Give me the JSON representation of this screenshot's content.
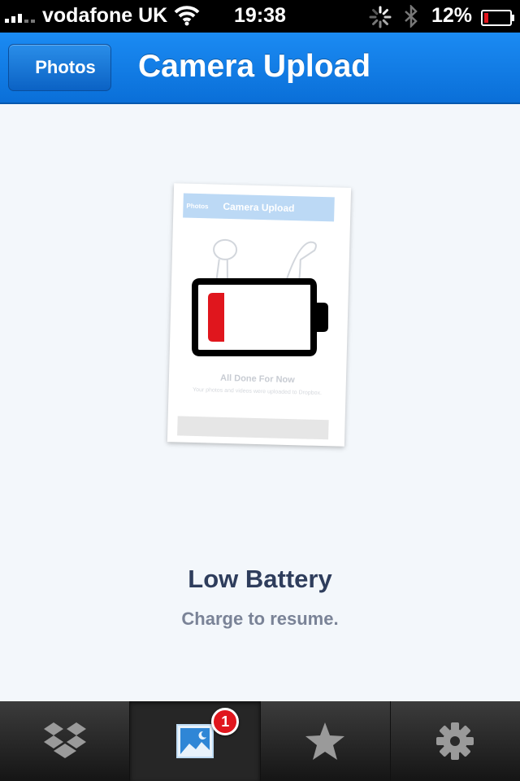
{
  "status_bar": {
    "carrier": "vodafone UK",
    "time": "19:38",
    "battery_percent": "12%",
    "icons": [
      "signal-icon",
      "wifi-icon",
      "activity-spinner-icon",
      "bluetooth-icon",
      "battery-icon"
    ]
  },
  "nav": {
    "back_label": "Photos",
    "title": "Camera Upload"
  },
  "preview": {
    "nav_title": "Camera Upload",
    "back_label": "Photos",
    "title": "All Done For Now",
    "subtitle": "Your photos and videos were uploaded to Dropbox."
  },
  "message": {
    "title": "Low Battery",
    "subtitle": "Charge to resume."
  },
  "tabs": [
    {
      "name": "dropbox",
      "icon": "dropbox-icon",
      "active": false
    },
    {
      "name": "photos",
      "icon": "photos-icon",
      "active": true,
      "badge": "1"
    },
    {
      "name": "favorites",
      "icon": "star-icon",
      "active": false
    },
    {
      "name": "settings",
      "icon": "gear-icon",
      "active": false
    }
  ],
  "colors": {
    "nav_blue": "#0a6fd8",
    "battery_red": "#e0161d",
    "badge_red": "#e0161d"
  }
}
